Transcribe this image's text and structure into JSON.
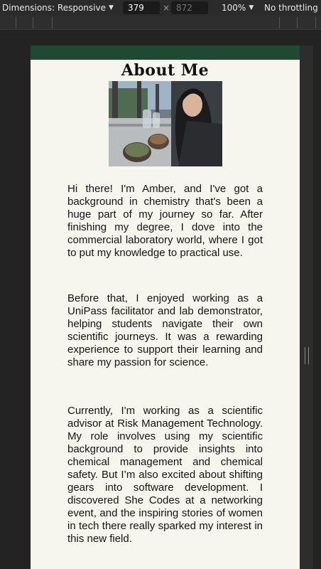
{
  "devtools": {
    "dimensions_label": "Dimensions: Responsive",
    "width_value": "379",
    "height_placeholder": "872",
    "times_symbol": "×",
    "zoom": "100%",
    "throttling": "No throttling"
  },
  "page": {
    "heading": "About Me",
    "paragraphs": [
      "Hi there! I'm Amber, and I've got a background in chemistry that's been a huge part of my journey so far. After finishing my degree, I dove into the commercial laboratory world, where I got to put my knowledge to practical use.",
      "Before that, I enjoyed working as a UniPass facilitator and lab demonstrator, helping students navigate their own scientific journeys. It was a rewarding experience to support their learning and share my passion for science.",
      "Currently, I'm working as a scientific advisor at Risk Management Technology. My role involves using my scientific background to provide insights into chemical management and chemical safety. But I’m also excited about shifting gears into software development. I discovered She Codes at a networking event, and the inspiring stories of women in tech there really sparked my interest in this new field."
    ]
  },
  "colors": {
    "nav_green": "#1f4a31",
    "page_bg": "#f6f5ee"
  }
}
